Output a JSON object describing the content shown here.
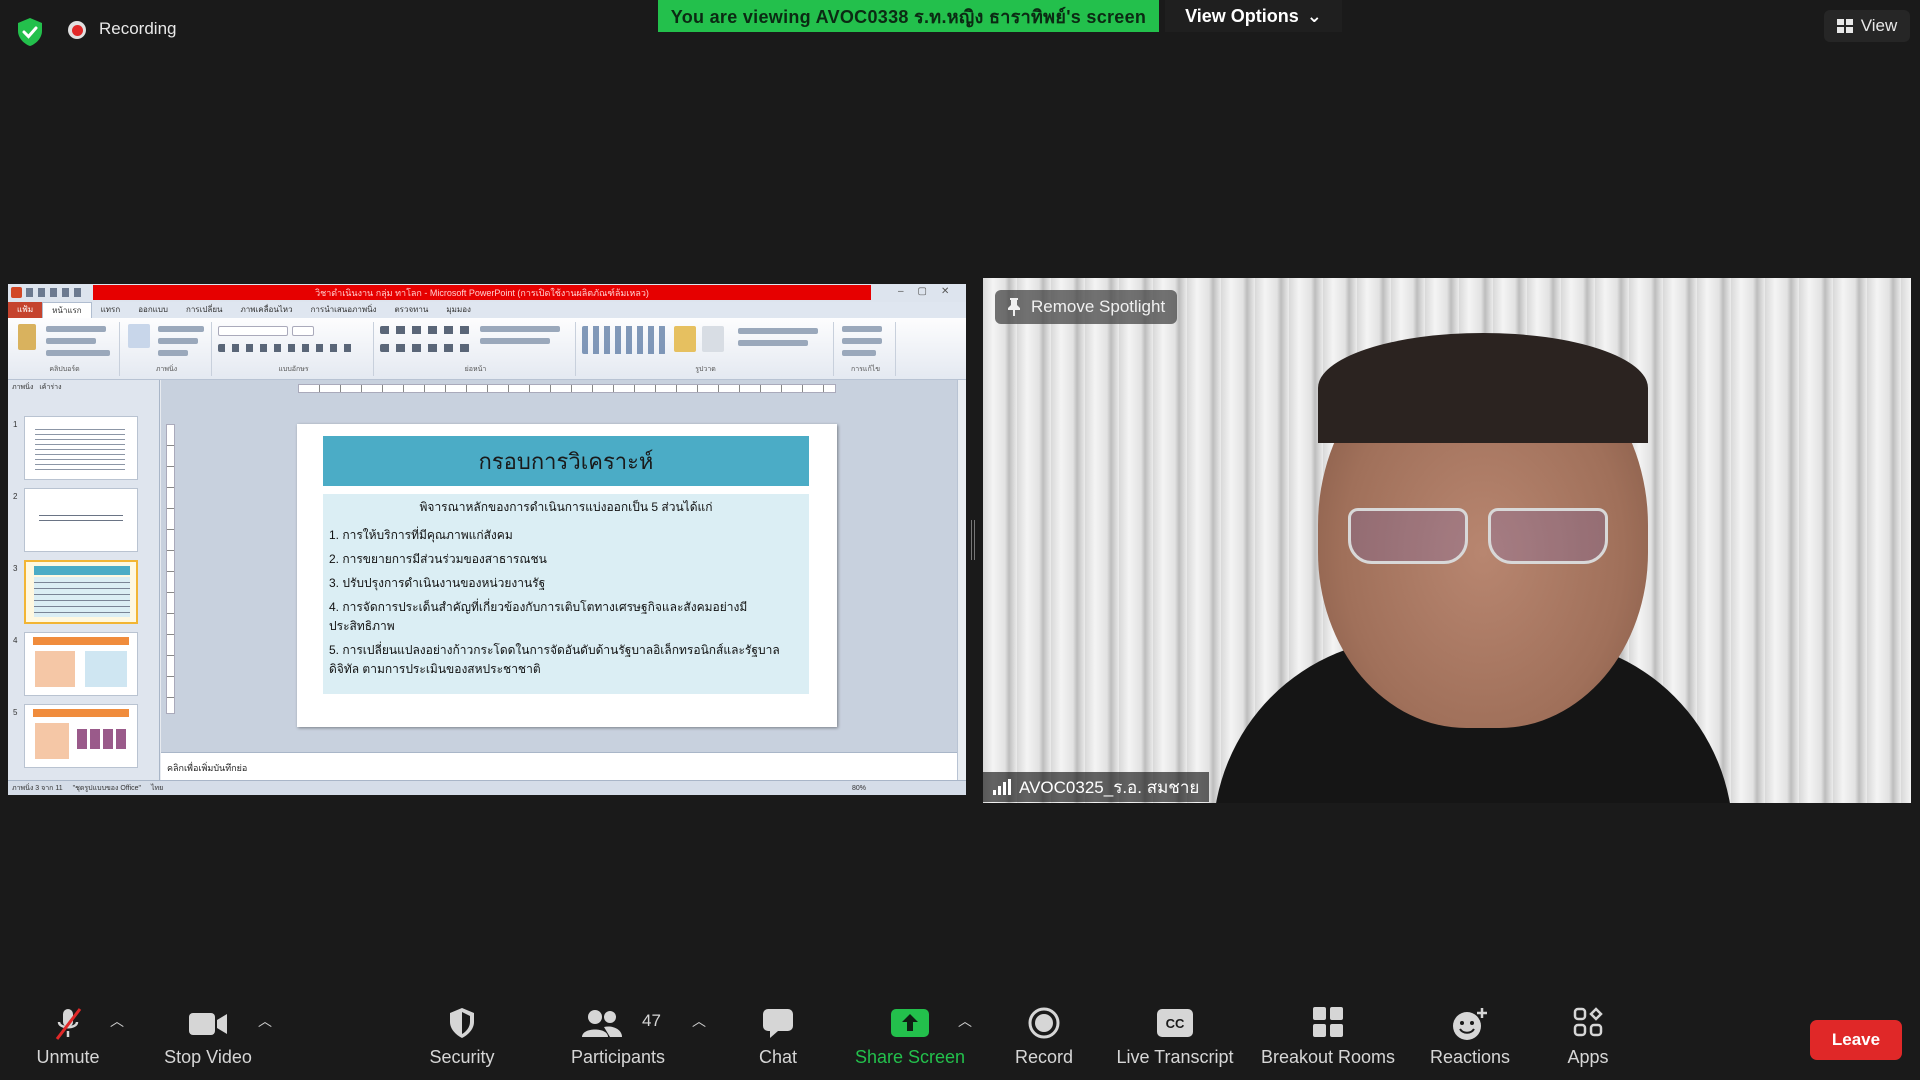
{
  "top_bar": {
    "recording_label": "Recording",
    "viewing_banner": "You are viewing AVOC0338 ร.ท.หญิง ธาราทิพย์'s screen",
    "view_options_label": "View Options",
    "view_label": "View"
  },
  "shared_screen": {
    "title": "วิชาดำเนินงาน กลุ่ม ทาโลก - Microsoft PowerPoint (การเปิดใช้งานผลิตภัณฑ์ล้มเหลว)",
    "tabs": [
      "แฟ้ม",
      "หน้าแรก",
      "แทรก",
      "ออกแบบ",
      "การเปลี่ยน",
      "ภาพเคลื่อนไหว",
      "การนำเสนอภาพนิ่ง",
      "ตรวจทาน",
      "มุมมอง"
    ],
    "ribbon_groups": [
      "คลิปบอร์ด",
      "ภาพนิ่ง",
      "แบบอักษร",
      "ย่อหน้า",
      "รูปวาด",
      "การแก้ไข"
    ],
    "panel_tabs": [
      "ภาพนิ่ง",
      "เค้าร่าง"
    ],
    "thumbnail_numbers": [
      "1",
      "2",
      "3",
      "4",
      "5"
    ],
    "slide": {
      "title": "กรอบการวิเคราะห์",
      "intro": "พิจารณาหลักของการดำเนินการแบ่งออกเป็น 5 ส่วนได้แก่",
      "items": [
        "1. การให้บริการที่มีคุณภาพแก่สังคม",
        "2. การขยายการมีส่วนร่วมของสาธารณชน",
        "3. ปรับปรุงการดำเนินงานของหน่วยงานรัฐ",
        "4. การจัดการประเด็นสำคัญที่เกี่ยวข้องกับการเติบโตทางเศรษฐกิจและสังคมอย่างมีประสิทธิภาพ",
        "5. การเปลี่ยนแปลงอย่างก้าวกระโดดในการจัดอันดับด้านรัฐบาลอิเล็กทรอนิกส์และรัฐบาลดิจิทัล ตามการประเมินของสหประชาชาติ"
      ]
    },
    "notes_placeholder": "คลิกเพื่อเพิ่มบันทึกย่อ",
    "status": {
      "slide_count": "ภาพนิ่ง 3 จาก 11",
      "theme": "\"ชุดรูปแบบของ Office\"",
      "language": "ไทย",
      "zoom": "80%"
    }
  },
  "video": {
    "remove_spotlight_label": "Remove Spotlight",
    "participant_name": "AVOC0325_ร.อ. สมชาย"
  },
  "toolbar": {
    "unmute_label": "Unmute",
    "stop_video_label": "Stop Video",
    "security_label": "Security",
    "participants_label": "Participants",
    "participants_count": "47",
    "chat_label": "Chat",
    "share_screen_label": "Share Screen",
    "record_label": "Record",
    "live_transcript_label": "Live Transcript",
    "breakout_rooms_label": "Breakout Rooms",
    "reactions_label": "Reactions",
    "apps_label": "Apps",
    "leave_label": "Leave"
  },
  "colors": {
    "banner_green": "#23c04c",
    "share_green": "#23c04c",
    "leave_red": "#e02828",
    "slide_header": "#4bacc6",
    "slide_body": "#dbeef4"
  }
}
